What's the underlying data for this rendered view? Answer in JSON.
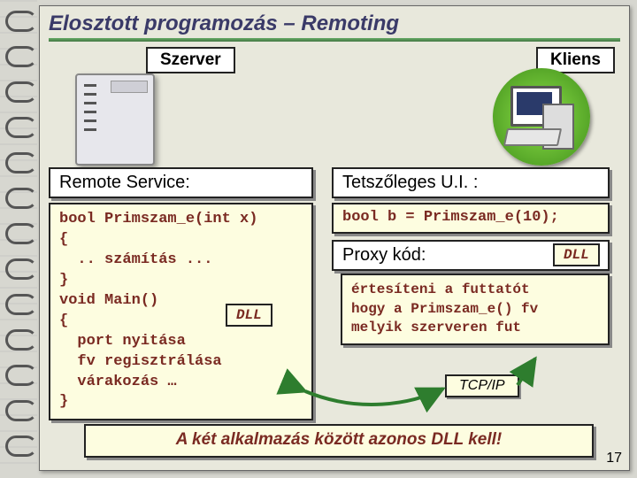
{
  "title": "Elosztott programozás – Remoting",
  "server_label": "Szerver",
  "client_label": "Kliens",
  "left_header": "Remote Service:",
  "right_header": "Tetszőleges U.I. :",
  "left_code": "bool Primszam_e(int x)\n{\n  .. számítás ...\n}\nvoid Main()\n{\n  port nyitása\n  fv regisztrálása\n  várakozás …\n}",
  "left_dll": "DLL",
  "right_call_code": "bool b = Primszam_e(10);",
  "proxy_header": "Proxy kód:",
  "right_dll": "DLL",
  "proxy_code": "értesíteni a futtatót\nhogy a Primszam_e() fv\nmelyik szerveren fut",
  "tcpip": "TCP/IP",
  "footer": "A két alkalmazás között azonos DLL kell!",
  "page": "17"
}
